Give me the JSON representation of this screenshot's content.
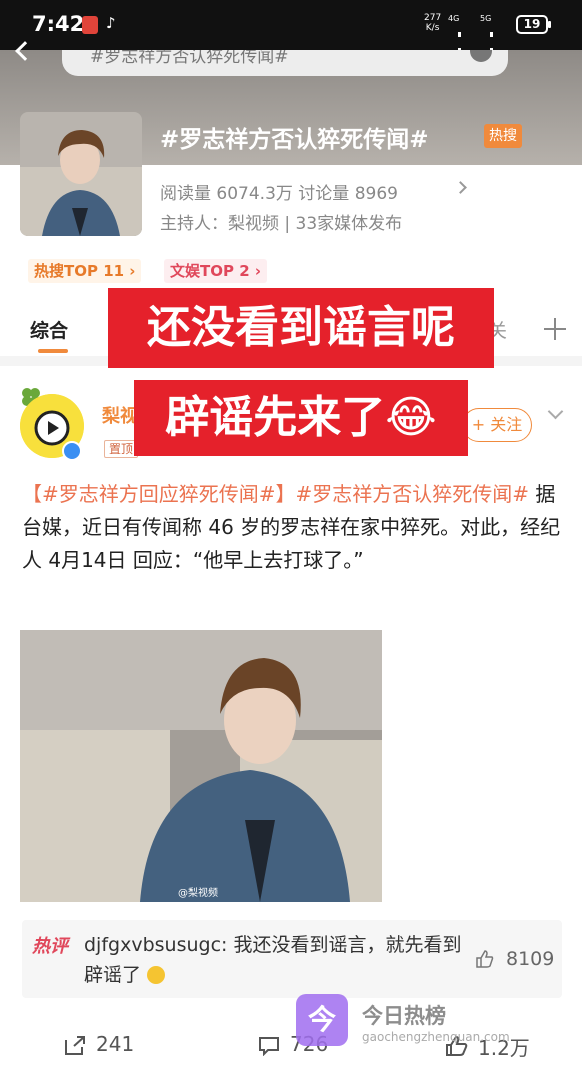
{
  "status_bar": {
    "time": "7:42",
    "net_speed_top": "277",
    "net_speed_bottom": "K/s",
    "sig1": "4G",
    "sig2": "5G",
    "battery": "19"
  },
  "search": {
    "query": "#罗志祥方否认猝死传闻#"
  },
  "topic": {
    "title": "#罗志祥方否认猝死传闻#",
    "badge": "热搜",
    "stats": "阅读量 6074.3万  讨论量 8969",
    "host": "主持人：梨视频 | 33家媒体发布",
    "tags": [
      "热搜TOP 11 ›",
      "文娱TOP 2 ›"
    ]
  },
  "tabs": {
    "active": "综合",
    "partial": "关"
  },
  "overlay": {
    "line1": "还没看到谣言呢",
    "line2": "辟谣先来了😂"
  },
  "post": {
    "author": "梨视",
    "pinned": "置顶",
    "follow": "+ 关注",
    "hashtag1": "【#罗志祥方回应猝死传闻#】",
    "hashtag2": "#罗志祥方否认猝死传闻#",
    "body": " 据台媒，近日有传闻称 46 岁的罗志祥在家中猝死。对此，经纪人 4月14日 回应：“他早上去打球了。”",
    "image_watermark": "@梨视频"
  },
  "hot_comment": {
    "label": "热评",
    "text": "djfgxvbsusugc: 我还没看到谣言，就先看到辟谣了",
    "likes": "8109"
  },
  "actions": {
    "reposts": "241",
    "comments": "726",
    "likes": "1.2万"
  },
  "watermark": {
    "logo_char": "今",
    "title": "今日热榜",
    "url": "gaochengzhenquan.com"
  },
  "colors": {
    "accent": "#f08a3c",
    "overlay_red": "#e5212b",
    "link": "#eb7350"
  }
}
